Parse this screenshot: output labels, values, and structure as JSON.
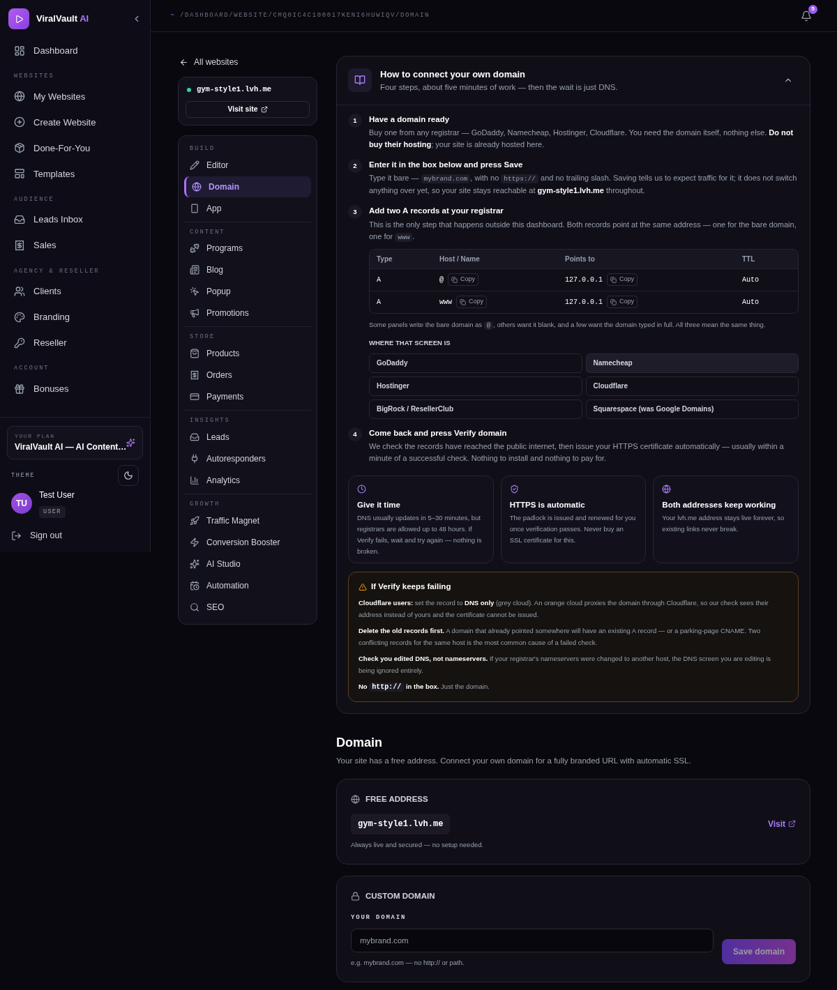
{
  "sidebar": {
    "brand": {
      "name": "ViralVault",
      "accent": "AI"
    },
    "sections": [
      {
        "items": [
          {
            "label": "Dashboard",
            "selected": false
          }
        ]
      },
      {
        "heading": "WEBSITES",
        "items": [
          {
            "label": "My Websites",
            "selected": false
          },
          {
            "label": "Create Website",
            "selected": false
          },
          {
            "label": "Done-For-You",
            "selected": false
          },
          {
            "label": "Templates",
            "selected": false
          }
        ]
      },
      {
        "heading": "AUDIENCE",
        "items": [
          {
            "label": "Leads Inbox",
            "selected": false
          },
          {
            "label": "Sales",
            "selected": false
          }
        ]
      },
      {
        "heading": "AGENCY & RESELLER",
        "items": [
          {
            "label": "Clients",
            "selected": false
          },
          {
            "label": "Branding",
            "selected": false
          },
          {
            "label": "Reseller",
            "selected": false
          }
        ]
      },
      {
        "heading": "ACCOUNT",
        "items": [
          {
            "label": "Bonuses",
            "selected": false
          }
        ]
      }
    ],
    "plan": {
      "label": "YOUR PLAN",
      "name": "ViralVault AI — AI Content…"
    },
    "theme": {
      "label": "THEME"
    },
    "user": {
      "initials": "TU",
      "name": "Test User",
      "role": "USER"
    },
    "sign_out": "Sign out"
  },
  "topbar": {
    "prefix": "~",
    "path": "/DASHBOARD/WEBSITE/CMQ0IC4C100017KENI6HUWIQV/DOMAIN",
    "notifications": "5"
  },
  "site_nav": {
    "back": "All websites",
    "site": {
      "domain": "gym-style1.lvh.me",
      "online": true,
      "visit": "Visit site"
    },
    "sections": [
      {
        "heading": "BUILD",
        "items": [
          {
            "label": "Editor",
            "selected": false
          },
          {
            "label": "Domain",
            "selected": true
          },
          {
            "label": "App",
            "selected": false
          }
        ]
      },
      {
        "heading": "CONTENT",
        "items": [
          {
            "label": "Programs",
            "selected": false
          },
          {
            "label": "Blog",
            "selected": false
          },
          {
            "label": "Popup",
            "selected": false
          },
          {
            "label": "Promotions",
            "selected": false
          }
        ]
      },
      {
        "heading": "STORE",
        "items": [
          {
            "label": "Products",
            "selected": false
          },
          {
            "label": "Orders",
            "selected": false
          },
          {
            "label": "Payments",
            "selected": false
          }
        ]
      },
      {
        "heading": "INSIGHTS",
        "items": [
          {
            "label": "Leads",
            "selected": false
          },
          {
            "label": "Autoresponders",
            "selected": false
          },
          {
            "label": "Analytics",
            "selected": false
          }
        ]
      },
      {
        "heading": "GROWTH",
        "items": [
          {
            "label": "Traffic Magnet",
            "selected": false
          },
          {
            "label": "Conversion Booster",
            "selected": false
          },
          {
            "label": "AI Studio",
            "selected": false
          },
          {
            "label": "Automation",
            "selected": false
          },
          {
            "label": "SEO",
            "selected": false
          }
        ]
      }
    ]
  },
  "guide": {
    "title": "How to connect your own domain",
    "subtitle": "Four steps, about five minutes of work — then the wait is just DNS.",
    "expanded": true,
    "steps": [
      {
        "number": "1",
        "title": "Have a domain ready",
        "body": [
          {
            "kind": "text",
            "text": "Buy one from any registrar — GoDaddy, Namecheap, Hostinger, Cloudflare. You need the domain itself, nothing else. "
          },
          {
            "kind": "strong",
            "text": "Do not buy their hosting"
          },
          {
            "kind": "text",
            "text": "; your site is already hosted here."
          }
        ]
      },
      {
        "number": "2",
        "title": "Enter it in the box below and press Save",
        "body": [
          {
            "kind": "text",
            "text": "Type it bare — "
          },
          {
            "kind": "code",
            "text": "mybrand.com"
          },
          {
            "kind": "text",
            "text": ", with no "
          },
          {
            "kind": "code",
            "text": "https://"
          },
          {
            "kind": "text",
            "text": " and no trailing slash. Saving tells us to expect traffic for it; it does not switch anything over yet, so your site stays reachable at "
          },
          {
            "kind": "strong",
            "text": "gym-style1.lvh.me"
          },
          {
            "kind": "text",
            "text": " throughout."
          }
        ]
      },
      {
        "number": "3",
        "title": "Add two A records at your registrar",
        "body": [
          {
            "kind": "text",
            "text": "This is the only step that happens outside this dashboard. Both records point at the same address — one for the bare domain, one for "
          },
          {
            "kind": "code",
            "text": "www"
          },
          {
            "kind": "text",
            "text": "."
          }
        ],
        "records": {
          "columns": [
            "Type",
            "Host / Name",
            "Points to",
            "TTL"
          ],
          "rows": [
            {
              "type": "A",
              "host": "@",
              "host_copy": "Copy",
              "points_to": "127.0.0.1",
              "points_copy": "Copy",
              "ttl": "Auto"
            },
            {
              "type": "A",
              "host": "www",
              "host_copy": "Copy",
              "points_to": "127.0.0.1",
              "points_copy": "Copy",
              "ttl": "Auto"
            }
          ]
        },
        "note": [
          {
            "kind": "text",
            "text": "Some panels write the bare domain as "
          },
          {
            "kind": "code",
            "text": "@"
          },
          {
            "kind": "text",
            "text": ", others want it blank, and a few want the domain typed in full. All three mean the same thing."
          }
        ],
        "registrars_heading": "WHERE THAT SCREEN IS",
        "registrars": [
          {
            "label": "GoDaddy",
            "selected": false
          },
          {
            "label": "Namecheap",
            "selected": true
          },
          {
            "label": "Hostinger",
            "selected": false
          },
          {
            "label": "Cloudflare",
            "selected": false
          },
          {
            "label": "BigRock / ResellerClub",
            "selected": false
          },
          {
            "label": "Squarespace (was Google Domains)",
            "selected": false
          }
        ]
      },
      {
        "number": "4",
        "title": "Come back and press Verify domain",
        "body": [
          {
            "kind": "text",
            "text": "We check the records have reached the public internet, then issue your HTTPS certificate automatically — usually within a minute of a successful check. Nothing to install and nothing to pay for."
          }
        ]
      }
    ],
    "tips": [
      {
        "title": "Give it time",
        "body": "DNS usually updates in 5–30 minutes, but registrars are allowed up to 48 hours. If Verify fails, wait and try again — nothing is broken."
      },
      {
        "title": "HTTPS is automatic",
        "body": "The padlock is issued and renewed for you once verification passes. Never buy an SSL certificate for this."
      },
      {
        "title": "Both addresses keep working",
        "body": "Your lvh.me address stays live forever, so existing links never break."
      }
    ],
    "warning": {
      "title": "If Verify keeps failing",
      "items": [
        [
          {
            "kind": "strong",
            "text": "Cloudflare users:"
          },
          {
            "kind": "text",
            "text": " set the record to "
          },
          {
            "kind": "strong",
            "text": "DNS only"
          },
          {
            "kind": "text",
            "text": " (grey cloud). An orange cloud proxies the domain through Cloudflare, so our check sees their address instead of yours and the certificate cannot be issued."
          }
        ],
        [
          {
            "kind": "strong",
            "text": "Delete the old records first."
          },
          {
            "kind": "text",
            "text": " A domain that already pointed somewhere will have an existing A record — or a parking-page CNAME. Two conflicting records for the same host is the most common cause of a failed check."
          }
        ],
        [
          {
            "kind": "strong",
            "text": "Check you edited DNS, not nameservers."
          },
          {
            "kind": "text",
            "text": " If your registrar's nameservers were changed to another host, the DNS screen you are editing is being ignored entirely."
          }
        ],
        [
          {
            "kind": "strong",
            "text": "No "
          },
          {
            "kind": "code",
            "text": "http://"
          },
          {
            "kind": "strong",
            "text": " in the box."
          },
          {
            "kind": "text",
            "text": " Just the domain."
          }
        ]
      ]
    }
  },
  "domain": {
    "title": "Domain",
    "subtitle": "Your site has a free address. Connect your own domain for a fully branded URL with automatic SSL.",
    "free": {
      "heading": "FREE ADDRESS",
      "address": "gym-style1.lvh.me",
      "visit": "Visit",
      "note": "Always live and secured — no setup needed."
    },
    "custom": {
      "heading": "CUSTOM DOMAIN",
      "label": "YOUR DOMAIN",
      "placeholder": "mybrand.com",
      "hint": "e.g. mybrand.com — no http:// or path.",
      "save": {
        "label": "Save domain",
        "disabled": true
      }
    }
  }
}
